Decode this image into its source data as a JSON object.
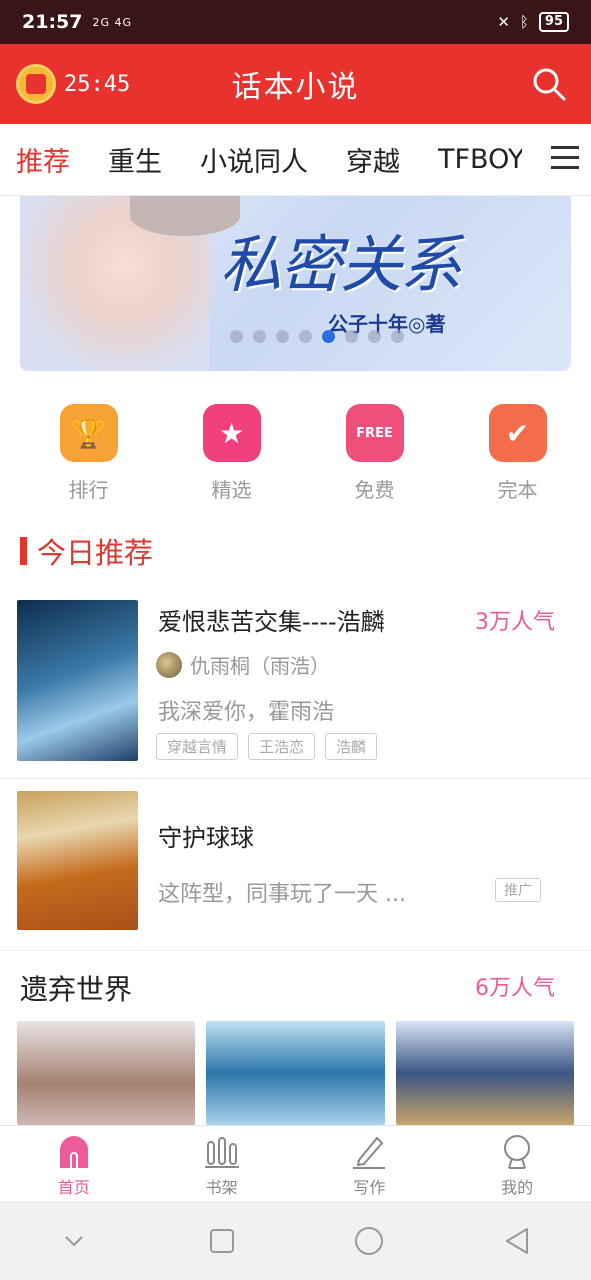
{
  "status_bar": {
    "time": "21:57",
    "signal": "2G 4G",
    "battery": "95"
  },
  "app_bar": {
    "timer": "25:45",
    "title": "话本小说"
  },
  "tabs": [
    {
      "label": "推荐"
    },
    {
      "label": "重生"
    },
    {
      "label": "小说同人"
    },
    {
      "label": "穿越"
    },
    {
      "label": "TFBOYS"
    }
  ],
  "banner": {
    "title": "私密关系",
    "author": "公子十年◎著",
    "slide_count": 8,
    "active_slide": 5
  },
  "quick_links": [
    {
      "label": "排行",
      "icon": "trophy-icon",
      "color": "#f7a234"
    },
    {
      "label": "精选",
      "icon": "star-icon",
      "color": "#f0407d"
    },
    {
      "label": "免费",
      "icon": "free-icon",
      "color": "#f04f7c",
      "badge": "FREE"
    },
    {
      "label": "完本",
      "icon": "check-icon",
      "color": "#f36d4a"
    }
  ],
  "today_section": {
    "title": "今日推荐"
  },
  "books": [
    {
      "title": "爱恨悲苦交集----浩麟",
      "popularity": "3万人气",
      "author": "仇雨桐（雨浩）",
      "description": "我深爱你，霍雨浩",
      "tags": [
        "穿越言情",
        "王浩恋",
        "浩麟"
      ]
    },
    {
      "title": "守护球球",
      "description": "这阵型，同事玩了一天 ...",
      "ad_label": "推广"
    }
  ],
  "collection": {
    "title": "遗弃世界",
    "popularity": "6万人气"
  },
  "bottom_nav": [
    {
      "label": "首页",
      "icon": "home-icon"
    },
    {
      "label": "书架",
      "icon": "shelf-icon"
    },
    {
      "label": "写作",
      "icon": "pencil-icon"
    },
    {
      "label": "我的",
      "icon": "profile-icon"
    }
  ],
  "colors": {
    "primary": "#e8322e",
    "accent_pink": "#ec5c9a"
  }
}
